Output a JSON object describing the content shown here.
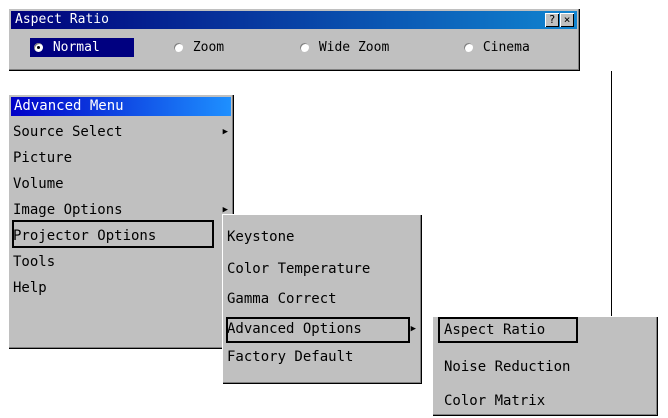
{
  "aspect_ratio_window": {
    "title": "Aspect Ratio",
    "help_label": "?",
    "close_label": "×",
    "options": [
      {
        "label": "Normal",
        "selected": true
      },
      {
        "label": "Zoom",
        "selected": false
      },
      {
        "label": "Wide Zoom",
        "selected": false
      },
      {
        "label": "Cinema",
        "selected": false
      }
    ]
  },
  "advanced_menu": {
    "title": "Advanced Menu",
    "items": [
      {
        "label": "Source Select",
        "submenu": true
      },
      {
        "label": "Picture",
        "submenu": false
      },
      {
        "label": "Volume",
        "submenu": false
      },
      {
        "label": "Image Options",
        "submenu": true,
        "highlighted": true
      },
      {
        "label": "Projector Options",
        "submenu": true
      },
      {
        "label": "Tools",
        "submenu": true
      },
      {
        "label": "Help",
        "submenu": true
      }
    ]
  },
  "image_options_menu": {
    "items": [
      {
        "label": "Keystone",
        "submenu": false
      },
      {
        "label": "Color Temperature",
        "submenu": false
      },
      {
        "label": "Gamma Correct",
        "submenu": false
      },
      {
        "label": "Advanced Options",
        "submenu": true,
        "highlighted": true
      },
      {
        "label": "Factory Default",
        "submenu": false
      }
    ]
  },
  "advanced_options_menu": {
    "items": [
      {
        "label": "Aspect Ratio",
        "highlighted": true
      },
      {
        "label": "Noise Reduction"
      },
      {
        "label": "Color Matrix"
      }
    ]
  },
  "icons": {
    "submenu_arrow": "▶",
    "radio_button": "radio-icon"
  },
  "colors": {
    "titlebar_start": "#00007b",
    "titlebar_end": "#1084d0",
    "panel": "#c0c0c0",
    "selection": "#000080"
  }
}
